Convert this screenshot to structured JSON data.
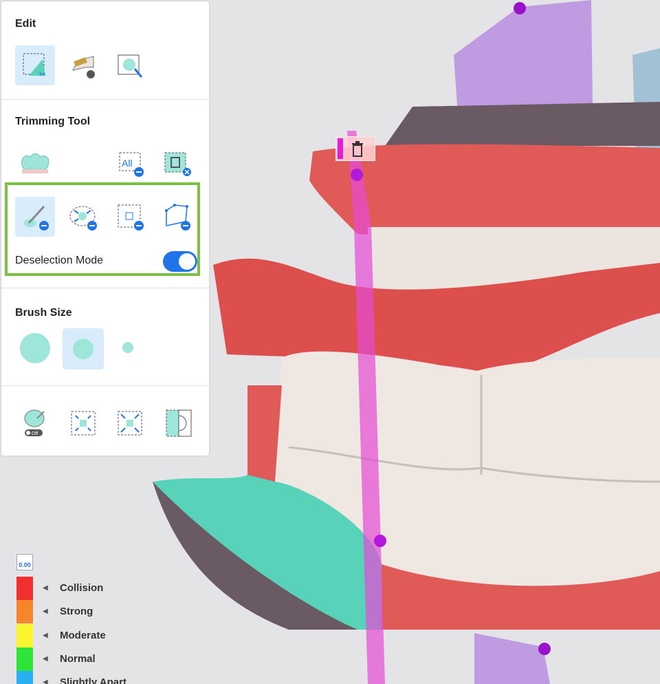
{
  "panel": {
    "edit": {
      "title": "Edit"
    },
    "trimming": {
      "title": "Trimming Tool",
      "all_label": "All"
    },
    "mode": {
      "label": "Deselection Mode",
      "enabled": true
    },
    "brush": {
      "title": "Brush Size",
      "selected": "medium"
    },
    "bottom_tools": {
      "toggle_off_label": "Off"
    }
  },
  "legend": {
    "icon_value": "0.00",
    "items": [
      {
        "label": "Collision",
        "color": "#f23030"
      },
      {
        "label": "Strong",
        "color": "#f7862a"
      },
      {
        "label": "Moderate",
        "color": "#fbf530"
      },
      {
        "label": "Normal",
        "color": "#2ee43a"
      },
      {
        "label": "Slightly Apart",
        "color": "#2ab0f2"
      }
    ]
  },
  "colors": {
    "accent": "#1e74e8",
    "highlight_border": "#7cc143",
    "active_tool_bg": "#d9ecfb"
  }
}
